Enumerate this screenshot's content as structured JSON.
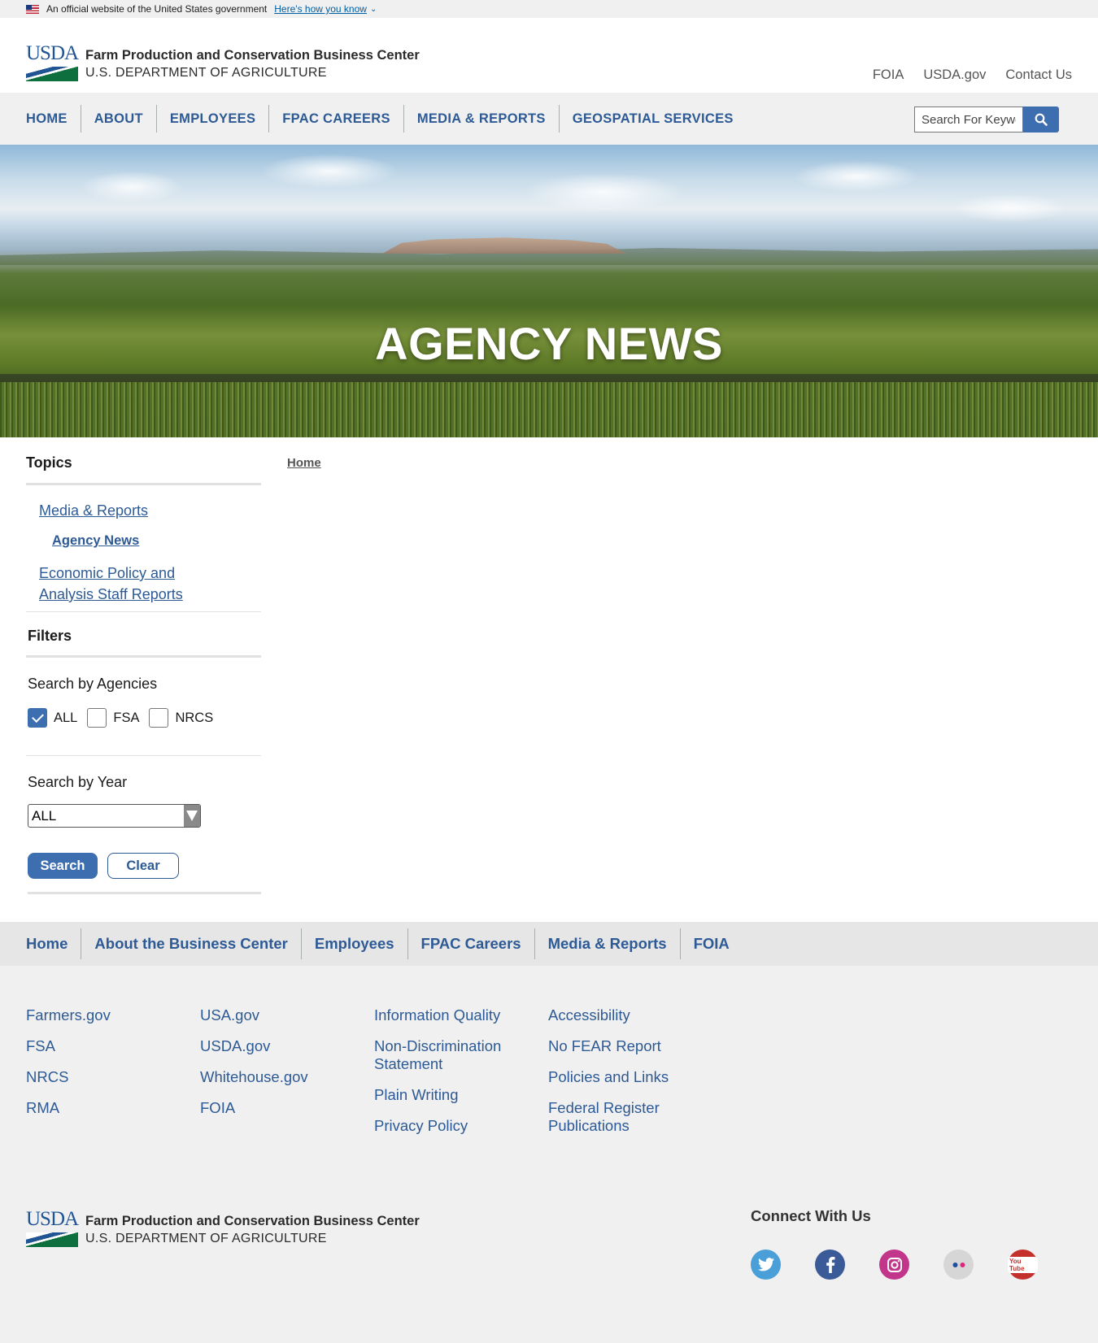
{
  "gov_banner": {
    "text": "An official website of the United States government",
    "link": "Here's how you know"
  },
  "header": {
    "logo_mark": "USDA",
    "agency": "Farm Production and Conservation Business Center",
    "department": "U.S. DEPARTMENT OF AGRICULTURE",
    "utility_links": [
      "FOIA",
      "USDA.gov",
      "Contact Us"
    ]
  },
  "main_nav": {
    "items": [
      "HOME",
      "ABOUT",
      "EMPLOYEES",
      "FPAC CAREERS",
      "MEDIA & REPORTS",
      "GEOSPATIAL SERVICES"
    ],
    "search_placeholder": "Search For Keywords"
  },
  "hero": {
    "title": "AGENCY NEWS"
  },
  "breadcrumb": {
    "home": "Home"
  },
  "sidebar": {
    "topics_heading": "Topics",
    "topics": {
      "media": "Media & Reports",
      "agency_news": "Agency News",
      "economic": "Economic Policy and Analysis Staff Reports"
    },
    "filters_heading": "Filters",
    "agencies_label": "Search by Agencies",
    "agencies": [
      {
        "label": "ALL",
        "checked": true
      },
      {
        "label": "FSA",
        "checked": false
      },
      {
        "label": "NRCS",
        "checked": false
      }
    ],
    "year_label": "Search by Year",
    "year_value": "ALL",
    "search_button": "Search",
    "clear_button": "Clear"
  },
  "footer_nav": {
    "items": [
      "Home",
      "About the Business Center",
      "Employees",
      "FPAC Careers",
      "Media & Reports",
      "FOIA"
    ]
  },
  "footer_links": {
    "col1": [
      "Farmers.gov",
      "FSA",
      "NRCS",
      "RMA"
    ],
    "col2": [
      "USA.gov",
      "USDA.gov",
      "Whitehouse.gov",
      "FOIA"
    ],
    "col3": [
      "Information Quality",
      "Non-Discrimination Statement",
      "Plain Writing",
      "Privacy Policy"
    ],
    "col4": [
      "Accessibility",
      "No FEAR Report",
      "Policies and Links",
      "Federal Register Publications"
    ]
  },
  "footer_logo": {
    "logo_mark": "USDA",
    "agency": "Farm Production and Conservation Business Center",
    "department": "U.S. DEPARTMENT OF AGRICULTURE"
  },
  "connect": {
    "heading": "Connect With Us",
    "icons": [
      "twitter-icon",
      "facebook-icon",
      "instagram-icon",
      "flickr-icon",
      "youtube-icon"
    ],
    "youtube_text": "You Tube"
  },
  "colors": {
    "link": "#2d5a95",
    "primary_button": "#3d6fb0",
    "nav_bg": "#f0f0f0",
    "twitter": "#4a9fd8",
    "facebook": "#3b5a98",
    "instagram": "#c1358a",
    "flickr": "#d6d6d6",
    "youtube": "#c4302b"
  }
}
